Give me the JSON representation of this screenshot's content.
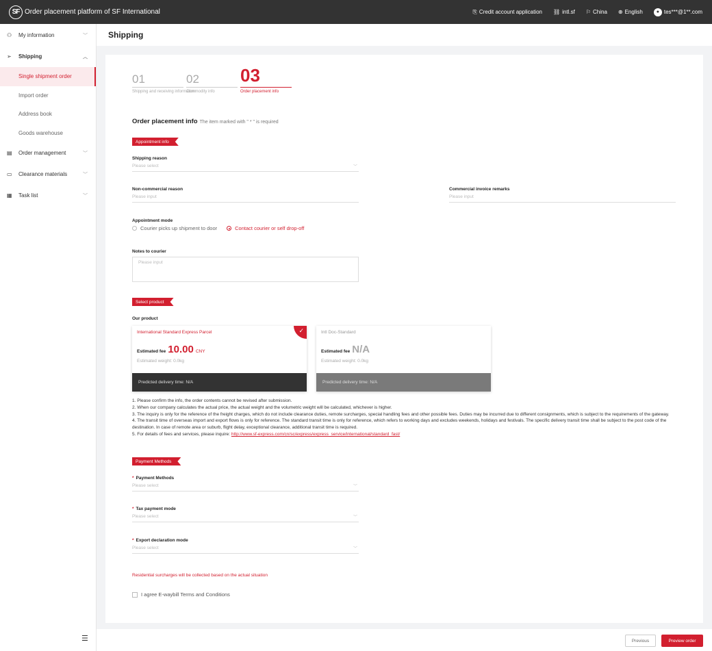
{
  "topbar": {
    "logo_text": "SF",
    "app_title": "Order placement platform of SF International",
    "credit": "Credit account application",
    "intl": "intl.sf",
    "region": "China",
    "language": "English",
    "user": "tes***@1**.com"
  },
  "sidebar": {
    "items": [
      {
        "label": "My information",
        "icon": "user-icon"
      },
      {
        "label": "Shipping",
        "icon": "send-icon"
      },
      {
        "label": "Order management",
        "icon": "file-icon"
      },
      {
        "label": "Clearance materials",
        "icon": "folder-icon"
      },
      {
        "label": "Task list",
        "icon": "calendar-icon"
      }
    ],
    "subitems": [
      {
        "label": "Single shipment order"
      },
      {
        "label": "Import order"
      },
      {
        "label": "Address book"
      },
      {
        "label": "Goods warehouse"
      }
    ]
  },
  "page": {
    "title": "Shipping"
  },
  "steps": [
    {
      "num": "01",
      "label": "Shipping and receiving information"
    },
    {
      "num": "02",
      "label": "Commodity info"
    },
    {
      "num": "03",
      "label": "Order placement info"
    }
  ],
  "form": {
    "section_title": "Order placement info",
    "required_note": "The item marked with \" * \" is required",
    "appointment_tag": "Appointment info",
    "shipping_reason": {
      "label": "Shipping reason",
      "placeholder": "Please select"
    },
    "non_commercial": {
      "label": "Non-commercial reason",
      "placeholder": "Please input"
    },
    "invoice_remarks": {
      "label": "Commercial invoice remarks",
      "placeholder": "Please input"
    },
    "appointment_mode": {
      "label": "Appointment mode",
      "option1": "Courier picks up shipment to door",
      "option2": "Contact courier or self drop-off"
    },
    "notes_courier": {
      "label": "Notes to courier",
      "placeholder": "Please input"
    },
    "product_tag": "Select product",
    "our_product": "Our product",
    "products": [
      {
        "name": "International Standard Express Parcel",
        "fee_label": "Estimated fee",
        "fee": "10.00",
        "currency": "CNY",
        "weight": "Estimated weight: 0.0kg",
        "delivery": "Predicted delivery time:   N/A"
      },
      {
        "name": "Intl Doc-Standard",
        "fee_label": "Estimated fee",
        "fee": "N/A",
        "weight": "Estimated weight: 0.0kg",
        "delivery": "Predicted delivery time:   N/A"
      }
    ],
    "notes": [
      "1. Please confirm the info, the order contents cannot be revised after submission.",
      "2. When our company calculates the actual price, the actual weight and the volumetric weight will be calculated, whichever is higher.",
      "3. The inquiry is only for the reference of the freight charges, which do not include clearance duties, remote surcharges, special handling fees and other possible fees. Duties may be incurred due to different consignments, which is subject to the requirements of the gateway.",
      "4. The transit time of overseas import and export flows is only for reference. The standard transit time is only for reference, which refers to working days and excludes weekends, holidays and festivals. The specific delivery transit time shall be subject to the post code of the destination. In case of remote area or suburb, flight delay, exceptional clearance, additional transit time is required.",
      "5. For details of fees and services, please inquire: "
    ],
    "notes_link": "http://www.sf-express.com/cn/sc/express/express_service/international/standard_fast/",
    "payment_tag": "Payment Methods",
    "payment_method": {
      "label": "Payment Methods",
      "placeholder": "Please select"
    },
    "tax_mode": {
      "label": "Tax payment mode",
      "placeholder": "Please select"
    },
    "export_mode": {
      "label": "Export declaration mode",
      "placeholder": "Please select"
    },
    "surcharge": "Residential surcharges will be collected based on the actual situation",
    "agree": "I agree E-waybill Terms and Conditions"
  },
  "footer": {
    "previous": "Previous",
    "preview": "Preview order"
  },
  "colors": {
    "accent": "#d21f2f",
    "topbar": "#333333"
  }
}
